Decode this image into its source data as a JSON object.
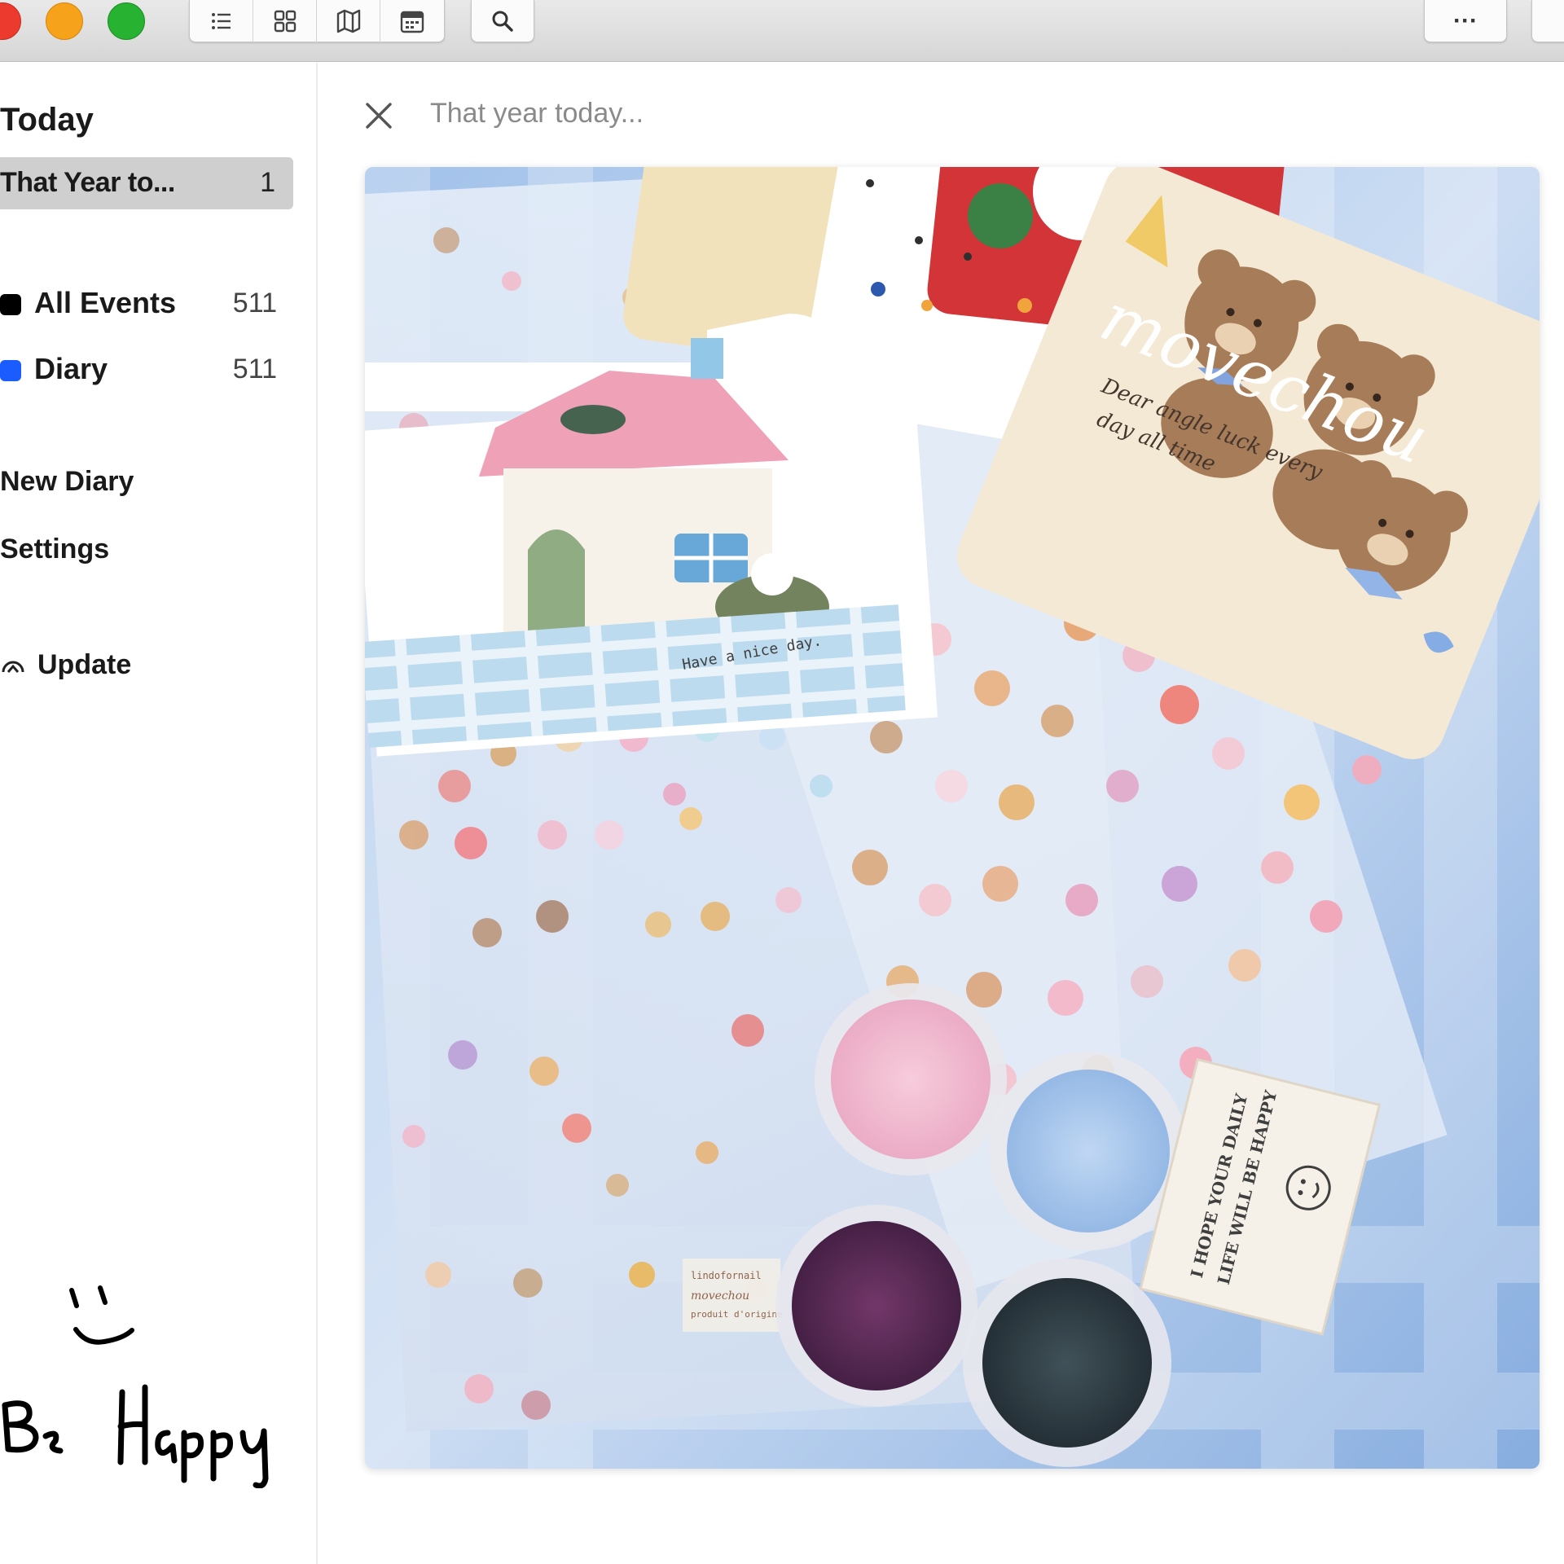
{
  "toolbar": {
    "buttons": [
      "list-view",
      "grid-view",
      "map-view",
      "calendar-view"
    ],
    "search_icon": "search-icon",
    "more_label": "···"
  },
  "sidebar": {
    "heading": "Today",
    "selected_item": {
      "label": "That Year to...",
      "count": "1"
    },
    "collections": [
      {
        "label": "All Events",
        "count": "511",
        "color": "#000000"
      },
      {
        "label": "Diary",
        "count": "511",
        "color": "#1a5cff"
      }
    ],
    "links": [
      "New Diary",
      "Settings"
    ],
    "update_label": "Update",
    "handwriting_icon": "smiley-face-icon"
  },
  "handwriting_text": "Be Happy",
  "main": {
    "search_placeholder": "That year today...",
    "photo_texts": {
      "brand_script": "movechou",
      "card_script_line1": "Dear angle luck every",
      "card_script_line2": "day all time",
      "card_small": "Have a nice day.",
      "patch_line1": "I HOPE YOUR DAILY",
      "patch_line2": "LIFE WILL BE HAPPY",
      "sticker_label1": "lindofornail",
      "sticker_label2": "movechou",
      "sticker_label3": "produit d'origine"
    },
    "powders": [
      {
        "color": "#f2b8cf"
      },
      {
        "color": "#a9c8ee"
      },
      {
        "color": "#4a1e4a"
      },
      {
        "color": "#24343c"
      }
    ]
  }
}
